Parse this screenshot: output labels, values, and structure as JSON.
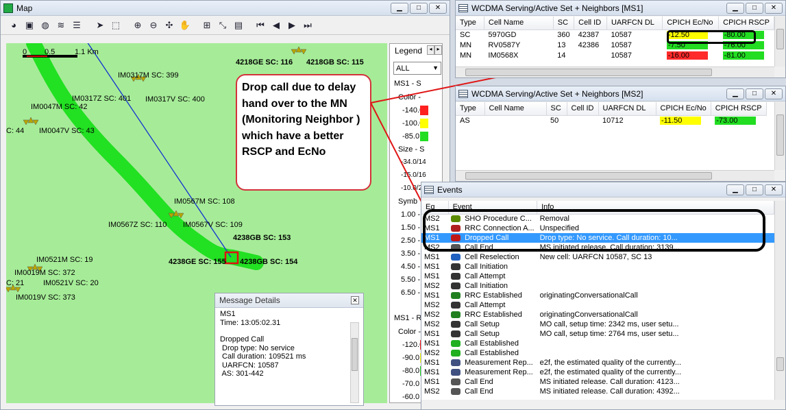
{
  "map": {
    "title": "Map",
    "scale_labels": [
      "0",
      "0.5",
      "1.1 Km"
    ],
    "sites": [
      {
        "id": "s1",
        "label": "4218GE SC: 116"
      },
      {
        "id": "s2",
        "label": "4218GB SC: 115"
      },
      {
        "id": "s3",
        "label": "IM0317M SC: 399"
      },
      {
        "id": "s4",
        "label": "IM0317Z SC: 401"
      },
      {
        "id": "s5",
        "label": "IM0317V SC: 400"
      },
      {
        "id": "s6",
        "label": "IM0047M SC: 42"
      },
      {
        "id": "s7",
        "label": "C: 44"
      },
      {
        "id": "s8",
        "label": "IM0047V SC: 43"
      },
      {
        "id": "s9",
        "label": "IM0567M SC: 108"
      },
      {
        "id": "s10",
        "label": "IM0567Z SC: 110"
      },
      {
        "id": "s11",
        "label": "IM0567V SC: 109"
      },
      {
        "id": "s12",
        "label": "4238GB SC: 153"
      },
      {
        "id": "s13",
        "label": "4238GE SC: 155"
      },
      {
        "id": "s14",
        "label": "4238GB SC: 154"
      },
      {
        "id": "s15",
        "label": "IM0521M SC: 19"
      },
      {
        "id": "s16",
        "label": "IM0019M SC: 372"
      },
      {
        "id": "s17",
        "label": "C: 21"
      },
      {
        "id": "s18",
        "label": "IM0521V SC: 20"
      },
      {
        "id": "s19",
        "label": "IM0019V SC: 373"
      }
    ],
    "legend": {
      "title": "Legend",
      "filter": "ALL",
      "sec1": "MS1 - S",
      "color_lbl": "Color -",
      "c_vals": [
        "-140.0",
        "-100.0",
        "-85.0"
      ],
      "size_lbl": "Size - S",
      "s_vals": [
        "-34.0/14",
        "-15.0/16",
        "-10.0/2"
      ],
      "symb_lbl": "Symb",
      "symb_vals": [
        "1.00 -",
        "1.50 -",
        "2.50 -",
        "3.50 -",
        "4.50 -",
        "5.50 -",
        "6.50 -"
      ],
      "sec2": "MS1 - R",
      "color2_lbl": "Color -",
      "c2_vals": [
        "-120.0",
        "-90.0",
        "-80.0",
        "-70.0",
        "-60.0"
      ],
      "colors": [
        "#ff2020",
        "#ffff00",
        "#22dd22"
      ]
    }
  },
  "message_details": {
    "title": "Message Details",
    "lines": [
      "MS1",
      "Time: 13:05:02.31",
      "",
      "Dropped Call",
      " Drop type: No service",
      " Call duration: 109521 ms",
      " UARFCN: 10587",
      " AS: 301-442"
    ]
  },
  "callout": {
    "text": "Drop call due to delay hand over to the MN (Monitoring Neighbor ) which have a better RSCP and EcNo"
  },
  "ms1_panel": {
    "title": "WCDMA Serving/Active Set + Neighbors [MS1]",
    "headers": [
      "Type",
      "Cell Name",
      "SC",
      "Cell ID",
      "UARFCN DL",
      "CPICH Ec/No",
      "CPICH RSCP"
    ],
    "rows": [
      {
        "type": "SC",
        "name": "5970GD",
        "sc": "360",
        "cid": "42387",
        "uarfcn": "10587",
        "ecno": "-12.50",
        "ecno_color": "#ffff00",
        "rscp": "-80.00",
        "rscp_color": "#22dd22"
      },
      {
        "type": "MN",
        "name": "RV0587Y",
        "sc": "13",
        "cid": "42386",
        "uarfcn": "10587",
        "ecno": "-7.50",
        "ecno_color": "#22dd22",
        "rscp": "-76.00",
        "rscp_color": "#22dd22"
      },
      {
        "type": "MN",
        "name": "IM0568X",
        "sc": "14",
        "cid": "",
        "uarfcn": "10587",
        "ecno": "-16.00",
        "ecno_color": "#ff2a2a",
        "rscp": "-81.00",
        "rscp_color": "#22dd22"
      }
    ]
  },
  "ms2_panel": {
    "title": "WCDMA Serving/Active Set + Neighbors [MS2]",
    "headers": [
      "Type",
      "Cell Name",
      "SC",
      "Cell ID",
      "UARFCN DL",
      "CPICH Ec/No",
      "CPICH RSCP"
    ],
    "rows": [
      {
        "type": "AS",
        "name": "",
        "sc": "50",
        "cid": "",
        "uarfcn": "10712",
        "ecno": "-11.50",
        "ecno_color": "#ffff00",
        "rscp": "-73.00",
        "rscp_color": "#22dd22"
      }
    ]
  },
  "events": {
    "title": "Events",
    "headers": [
      "Eq",
      "Event",
      "Info"
    ],
    "rows": [
      {
        "eq": "MS2",
        "event": "SHO Procedure C...",
        "info": "Removal",
        "icon": "sho-icon"
      },
      {
        "eq": "MS1",
        "event": "RRC Connection A...",
        "info": "Unspecified",
        "icon": "rrc-icon"
      },
      {
        "eq": "MS1",
        "event": "Dropped Call",
        "info": "Drop type: No service.  Call duration: 10...",
        "icon": "dropped-call-icon",
        "selected": true
      },
      {
        "eq": "MS2",
        "event": "Call End",
        "info": "MS initiated release.  Call duration: 3139...",
        "icon": "call-end-icon"
      },
      {
        "eq": "MS1",
        "event": "Cell Reselection",
        "info": "New cell: UARFCN 10587, SC 13",
        "icon": "reselection-icon"
      },
      {
        "eq": "MS1",
        "event": "Call Initiation",
        "info": "",
        "icon": "phone-icon"
      },
      {
        "eq": "MS1",
        "event": "Call Attempt",
        "info": "",
        "icon": "phone-icon"
      },
      {
        "eq": "MS2",
        "event": "Call Initiation",
        "info": "",
        "icon": "phone-icon"
      },
      {
        "eq": "MS1",
        "event": "RRC Established",
        "info": "originatingConversationalCall",
        "icon": "rrc-est-icon"
      },
      {
        "eq": "MS2",
        "event": "Call Attempt",
        "info": "",
        "icon": "phone-icon"
      },
      {
        "eq": "MS2",
        "event": "RRC Established",
        "info": "originatingConversationalCall",
        "icon": "rrc-est-icon"
      },
      {
        "eq": "MS2",
        "event": "Call Setup",
        "info": "MO call, setup time: 2342 ms, user setu...",
        "icon": "phone-icon"
      },
      {
        "eq": "MS1",
        "event": "Call Setup",
        "info": "MO call, setup time: 2764 ms, user setu...",
        "icon": "phone-icon"
      },
      {
        "eq": "MS1",
        "event": "Call Established",
        "info": "",
        "icon": "call-established-icon"
      },
      {
        "eq": "MS2",
        "event": "Call Established",
        "info": "",
        "icon": "call-established-icon"
      },
      {
        "eq": "MS1",
        "event": "Measurement Rep...",
        "info": "e2f, the estimated quality of the currently...",
        "icon": "measurement-icon"
      },
      {
        "eq": "MS1",
        "event": "Measurement Rep...",
        "info": "e2f, the estimated quality of the currently...",
        "icon": "measurement-icon"
      },
      {
        "eq": "MS1",
        "event": "Call End",
        "info": "MS initiated release.  Call duration: 4123...",
        "icon": "call-end-icon"
      },
      {
        "eq": "MS2",
        "event": "Call End",
        "info": "MS initiated release.  Call duration: 4392...",
        "icon": "call-end-icon"
      }
    ]
  }
}
